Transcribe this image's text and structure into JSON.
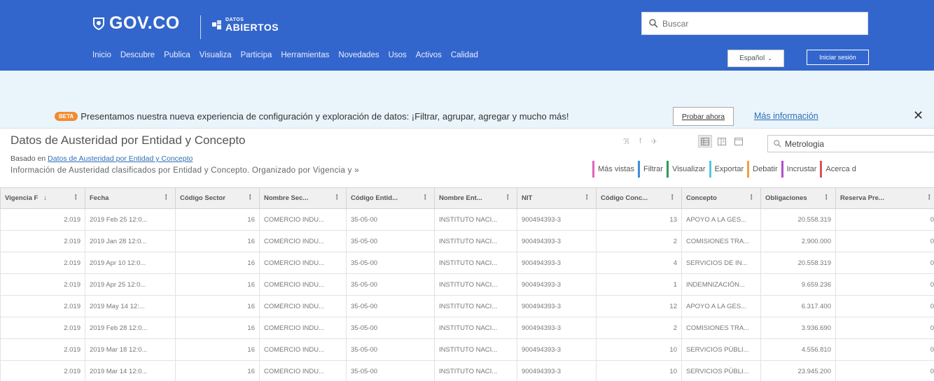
{
  "header": {
    "brand_gov": "GOV.CO",
    "brand_datos_small": "DATOS",
    "brand_datos_big": "ABIERTOS",
    "nav": [
      "Inicio",
      "Descubre",
      "Publica",
      "Visualiza",
      "Participa",
      "Herramientas",
      "Novedades",
      "Usos",
      "Activos",
      "Calidad"
    ],
    "search_placeholder": "Buscar",
    "language": "Español",
    "login": "Iniciar sesión"
  },
  "banner": {
    "badge": "BETA",
    "text": "Presentamos nuestra nueva experiencia de configuración y exploración de datos: ¡Filtrar, agrupar, agregar y mucho más!",
    "try_button": "Probar ahora",
    "more_info": "Más información"
  },
  "dataset": {
    "title": "Datos de Austeridad por Entidad y Concepto",
    "based_prefix": "Basado en",
    "based_link": "Datos de Austeridad por Entidad y Concepto",
    "description": "Información de Austeridad clasificados por Entidad y Concepto. Organizado por Vigencia y »",
    "search_value": "Metrologia",
    "actions": [
      {
        "label": "Más vistas",
        "color": "#e55fbf"
      },
      {
        "label": "Filtrar",
        "color": "#3b8ed8"
      },
      {
        "label": "Visualizar",
        "color": "#2d9b56"
      },
      {
        "label": "Exportar",
        "color": "#56c7e0"
      },
      {
        "label": "Debatir",
        "color": "#f0a040"
      },
      {
        "label": "Incrustar",
        "color": "#b04fc8"
      },
      {
        "label": "Acerca d",
        "color": "#e05050"
      }
    ]
  },
  "table": {
    "columns": [
      "Vigencia F",
      "Fecha",
      "Código Sector",
      "Nombre Sec...",
      "Código Entid...",
      "Nombre Ent...",
      "NIT",
      "Código Conc...",
      "Concepto",
      "Obligaciones",
      "Reserva Pre..."
    ],
    "rows": [
      [
        "2.019",
        "2019 Feb 25 12:0...",
        "16",
        "COMERCIO INDU...",
        "35-05-00",
        "INSTITUTO NACI...",
        "900494393-3",
        "13",
        "APOYO A LA GES...",
        "20.558.319",
        "0"
      ],
      [
        "2.019",
        "2019 Jan 28 12:0...",
        "16",
        "COMERCIO INDU...",
        "35-05-00",
        "INSTITUTO NACI...",
        "900494393-3",
        "2",
        "COMISIONES TRA...",
        "2.900.000",
        "0"
      ],
      [
        "2.019",
        "2019 Apr 10 12:0...",
        "16",
        "COMERCIO INDU...",
        "35-05-00",
        "INSTITUTO NACI...",
        "900494393-3",
        "4",
        "SERVICIOS DE IN...",
        "20.558.319",
        "0"
      ],
      [
        "2.019",
        "2019 Apr 25 12:0...",
        "16",
        "COMERCIO INDU...",
        "35-05-00",
        "INSTITUTO NACI...",
        "900494393-3",
        "1",
        "INDEMNIZACIÓN...",
        "9.659.236",
        "0"
      ],
      [
        "2.019",
        "2019 May 14 12:...",
        "16",
        "COMERCIO INDU...",
        "35-05-00",
        "INSTITUTO NACI...",
        "900494393-3",
        "12",
        "APOYO A LA GES...",
        "6.317.400",
        "0"
      ],
      [
        "2.019",
        "2019 Feb 28 12:0...",
        "16",
        "COMERCIO INDU...",
        "35-05-00",
        "INSTITUTO NACI...",
        "900494393-3",
        "2",
        "COMISIONES TRA...",
        "3.936.690",
        "0"
      ],
      [
        "2.019",
        "2019 Mar 18 12:0...",
        "16",
        "COMERCIO INDU...",
        "35-05-00",
        "INSTITUTO NACI...",
        "900494393-3",
        "10",
        "SERVICIOS PÚBLI...",
        "4.556.810",
        "0"
      ],
      [
        "2.019",
        "2019 Mar 14 12:0...",
        "16",
        "COMERCIO INDU...",
        "35-05-00",
        "INSTITUTO NACI...",
        "900494393-3",
        "10",
        "SERVICIOS PÚBLI...",
        "23.945.200",
        "0"
      ]
    ],
    "numeric_cols": [
      0,
      2,
      7,
      9,
      10
    ]
  }
}
